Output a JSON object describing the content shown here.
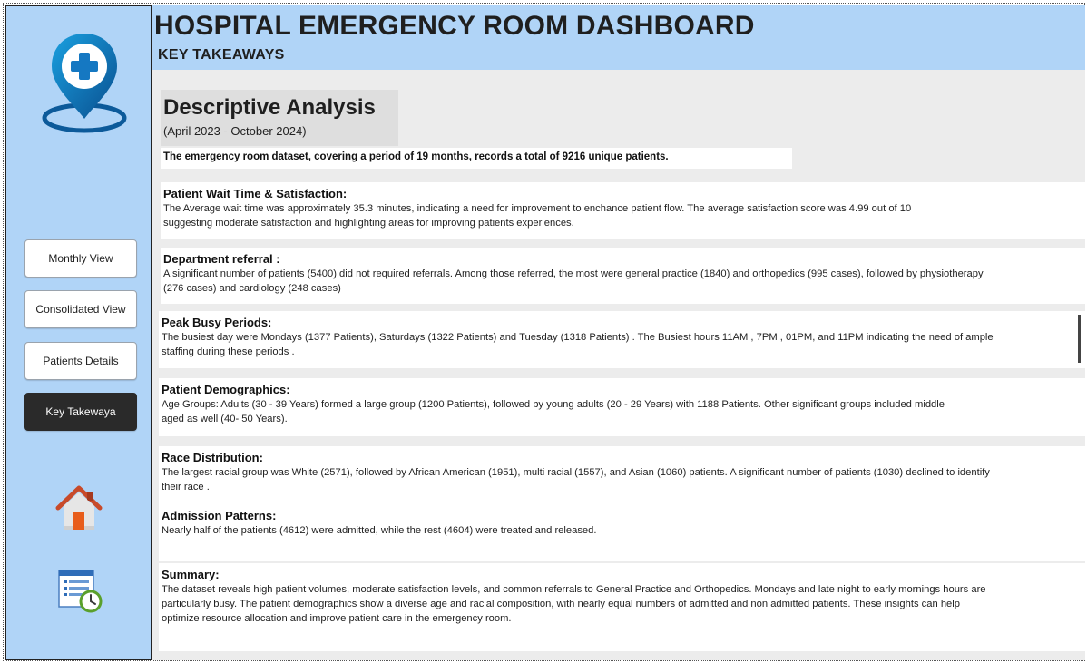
{
  "header": {
    "title": "HOSPITAL EMERGENCY ROOM DASHBOARD",
    "subtitle": "KEY TAKEAWAYS"
  },
  "sidebar": {
    "logo_icon": "hospital-location-pin-icon",
    "nav": [
      {
        "label": "Monthly View",
        "active": false
      },
      {
        "label": "Consolidated View",
        "active": false
      },
      {
        "label": "Patients Details",
        "active": false
      },
      {
        "label": "Key Takewaya",
        "active": true
      }
    ],
    "home_icon": "home-icon",
    "report_icon": "report-timer-icon"
  },
  "analysis": {
    "title": "Descriptive Analysis",
    "period": "(April 2023 - October 2024)",
    "intro": "The emergency room dataset, covering a period of 19 months, records a total of 9216 unique patients."
  },
  "sections": [
    {
      "title": "Patient Wait Time & Satisfaction:",
      "lines": [
        "The Average wait time was approximately 35.3 minutes, indicating a need for improvement to enchance patient flow. The average satisfaction score was 4.99 out of 10",
        "suggesting moderate satisfaction and highlighting areas for improving patients experiences."
      ]
    },
    {
      "title": "Department referral :",
      "lines": [
        "A significant number of patients (5400) did not required referrals. Among those referred, the most were general practice (1840) and orthopedics (995 cases), followed by physiotherapy",
        "(276 cases) and cardiology (248 cases)"
      ]
    },
    {
      "title": "Peak Busy Periods:",
      "lines": [
        "The busiest day were Mondays (1377 Patients), Saturdays (1322 Patients) and Tuesday (1318 Patients) . The Busiest hours 11AM , 7PM , 01PM, and 11PM indicating the need of ample",
        "staffing during these periods ."
      ]
    },
    {
      "title": "Patient Demographics:",
      "lines": [
        "Age Groups: Adults (30 - 39 Years) formed a large group (1200 Patients), followed by young adults (20 - 29 Years) with 1188 Patients. Other significant groups included middle",
        "aged as well (40- 50 Years)."
      ]
    },
    {
      "title": "Race Distribution:",
      "lines": [
        "The largest racial group was White (2571), followed by African American (1951), multi racial (1557), and Asian (1060) patients. A significant number of patients (1030) declined to identify",
        "their race ."
      ]
    },
    {
      "title": "Admission Patterns:",
      "lines": [
        "Nearly half of the patients (4612) were admitted, while the rest (4604) were treated and released."
      ]
    },
    {
      "title": "Summary:",
      "lines": [
        "The dataset reveals high patient volumes, moderate satisfaction levels, and common referrals to General Practice and Orthopedics. Mondays and late night to early mornings hours are",
        "particularly busy. The patient demographics show a diverse age and racial composition, with nearly equal numbers of admitted and non admitted patients. These insights can help",
        "optimize resource allocation and improve patient care in the emergency room."
      ]
    }
  ],
  "colors": {
    "header_bg": "#b0d4f7",
    "sidebar_bg": "#b0d4f7",
    "content_bg": "#ececec",
    "logo_blue": "#1578c2",
    "active_button": "#2a2a2a"
  }
}
